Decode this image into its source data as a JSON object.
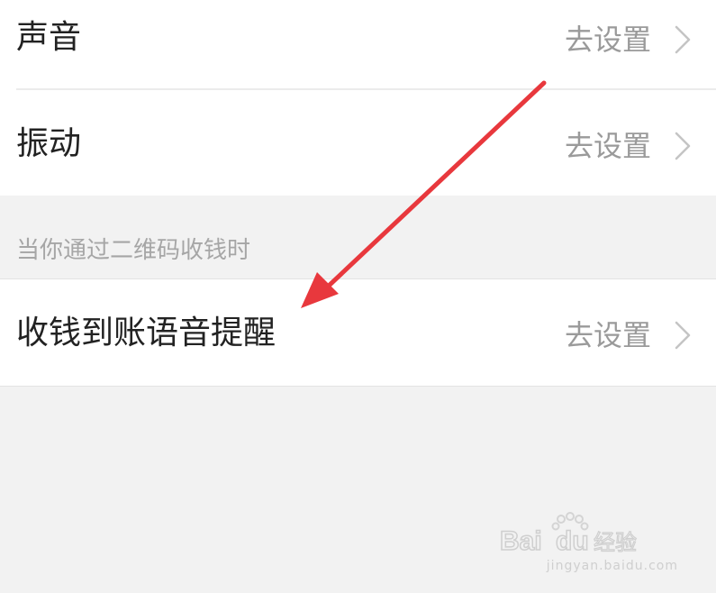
{
  "settings_rows": [
    {
      "label": "声音",
      "value": "去设置"
    },
    {
      "label": "振动",
      "value": "去设置"
    }
  ],
  "section_header": "当你通过二维码收钱时",
  "payment_row": {
    "label": "收钱到账语音提醒",
    "value": "去设置"
  },
  "annotation": {
    "color": "#e8383d",
    "icon": "red-arrow-icon"
  },
  "watermark": {
    "brand": "Bai du 经验",
    "url": "jingyan.baidu.com"
  }
}
